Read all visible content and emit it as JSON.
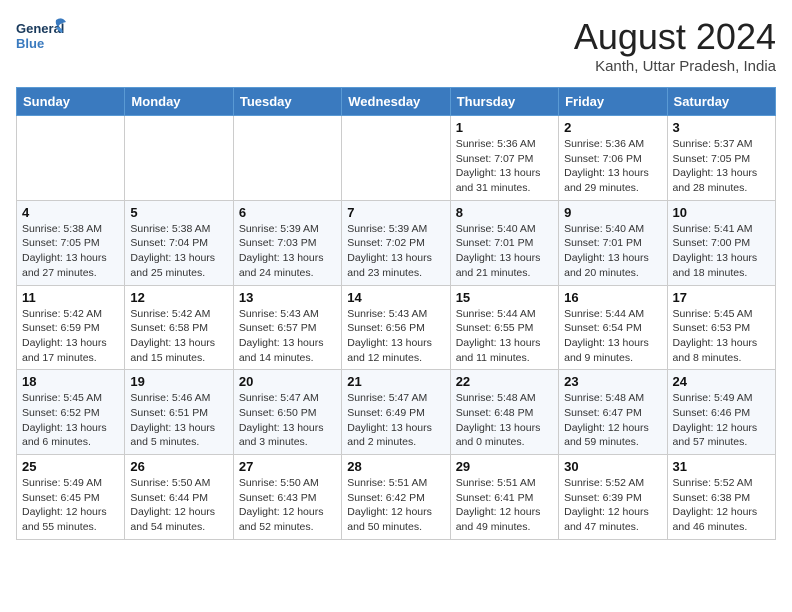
{
  "header": {
    "logo_general": "General",
    "logo_blue": "Blue",
    "month_year": "August 2024",
    "location": "Kanth, Uttar Pradesh, India"
  },
  "weekdays": [
    "Sunday",
    "Monday",
    "Tuesday",
    "Wednesday",
    "Thursday",
    "Friday",
    "Saturday"
  ],
  "weeks": [
    [
      {
        "day": "",
        "detail": ""
      },
      {
        "day": "",
        "detail": ""
      },
      {
        "day": "",
        "detail": ""
      },
      {
        "day": "",
        "detail": ""
      },
      {
        "day": "1",
        "detail": "Sunrise: 5:36 AM\nSunset: 7:07 PM\nDaylight: 13 hours\nand 31 minutes."
      },
      {
        "day": "2",
        "detail": "Sunrise: 5:36 AM\nSunset: 7:06 PM\nDaylight: 13 hours\nand 29 minutes."
      },
      {
        "day": "3",
        "detail": "Sunrise: 5:37 AM\nSunset: 7:05 PM\nDaylight: 13 hours\nand 28 minutes."
      }
    ],
    [
      {
        "day": "4",
        "detail": "Sunrise: 5:38 AM\nSunset: 7:05 PM\nDaylight: 13 hours\nand 27 minutes."
      },
      {
        "day": "5",
        "detail": "Sunrise: 5:38 AM\nSunset: 7:04 PM\nDaylight: 13 hours\nand 25 minutes."
      },
      {
        "day": "6",
        "detail": "Sunrise: 5:39 AM\nSunset: 7:03 PM\nDaylight: 13 hours\nand 24 minutes."
      },
      {
        "day": "7",
        "detail": "Sunrise: 5:39 AM\nSunset: 7:02 PM\nDaylight: 13 hours\nand 23 minutes."
      },
      {
        "day": "8",
        "detail": "Sunrise: 5:40 AM\nSunset: 7:01 PM\nDaylight: 13 hours\nand 21 minutes."
      },
      {
        "day": "9",
        "detail": "Sunrise: 5:40 AM\nSunset: 7:01 PM\nDaylight: 13 hours\nand 20 minutes."
      },
      {
        "day": "10",
        "detail": "Sunrise: 5:41 AM\nSunset: 7:00 PM\nDaylight: 13 hours\nand 18 minutes."
      }
    ],
    [
      {
        "day": "11",
        "detail": "Sunrise: 5:42 AM\nSunset: 6:59 PM\nDaylight: 13 hours\nand 17 minutes."
      },
      {
        "day": "12",
        "detail": "Sunrise: 5:42 AM\nSunset: 6:58 PM\nDaylight: 13 hours\nand 15 minutes."
      },
      {
        "day": "13",
        "detail": "Sunrise: 5:43 AM\nSunset: 6:57 PM\nDaylight: 13 hours\nand 14 minutes."
      },
      {
        "day": "14",
        "detail": "Sunrise: 5:43 AM\nSunset: 6:56 PM\nDaylight: 13 hours\nand 12 minutes."
      },
      {
        "day": "15",
        "detail": "Sunrise: 5:44 AM\nSunset: 6:55 PM\nDaylight: 13 hours\nand 11 minutes."
      },
      {
        "day": "16",
        "detail": "Sunrise: 5:44 AM\nSunset: 6:54 PM\nDaylight: 13 hours\nand 9 minutes."
      },
      {
        "day": "17",
        "detail": "Sunrise: 5:45 AM\nSunset: 6:53 PM\nDaylight: 13 hours\nand 8 minutes."
      }
    ],
    [
      {
        "day": "18",
        "detail": "Sunrise: 5:45 AM\nSunset: 6:52 PM\nDaylight: 13 hours\nand 6 minutes."
      },
      {
        "day": "19",
        "detail": "Sunrise: 5:46 AM\nSunset: 6:51 PM\nDaylight: 13 hours\nand 5 minutes."
      },
      {
        "day": "20",
        "detail": "Sunrise: 5:47 AM\nSunset: 6:50 PM\nDaylight: 13 hours\nand 3 minutes."
      },
      {
        "day": "21",
        "detail": "Sunrise: 5:47 AM\nSunset: 6:49 PM\nDaylight: 13 hours\nand 2 minutes."
      },
      {
        "day": "22",
        "detail": "Sunrise: 5:48 AM\nSunset: 6:48 PM\nDaylight: 13 hours\nand 0 minutes."
      },
      {
        "day": "23",
        "detail": "Sunrise: 5:48 AM\nSunset: 6:47 PM\nDaylight: 12 hours\nand 59 minutes."
      },
      {
        "day": "24",
        "detail": "Sunrise: 5:49 AM\nSunset: 6:46 PM\nDaylight: 12 hours\nand 57 minutes."
      }
    ],
    [
      {
        "day": "25",
        "detail": "Sunrise: 5:49 AM\nSunset: 6:45 PM\nDaylight: 12 hours\nand 55 minutes."
      },
      {
        "day": "26",
        "detail": "Sunrise: 5:50 AM\nSunset: 6:44 PM\nDaylight: 12 hours\nand 54 minutes."
      },
      {
        "day": "27",
        "detail": "Sunrise: 5:50 AM\nSunset: 6:43 PM\nDaylight: 12 hours\nand 52 minutes."
      },
      {
        "day": "28",
        "detail": "Sunrise: 5:51 AM\nSunset: 6:42 PM\nDaylight: 12 hours\nand 50 minutes."
      },
      {
        "day": "29",
        "detail": "Sunrise: 5:51 AM\nSunset: 6:41 PM\nDaylight: 12 hours\nand 49 minutes."
      },
      {
        "day": "30",
        "detail": "Sunrise: 5:52 AM\nSunset: 6:39 PM\nDaylight: 12 hours\nand 47 minutes."
      },
      {
        "day": "31",
        "detail": "Sunrise: 5:52 AM\nSunset: 6:38 PM\nDaylight: 12 hours\nand 46 minutes."
      }
    ]
  ]
}
